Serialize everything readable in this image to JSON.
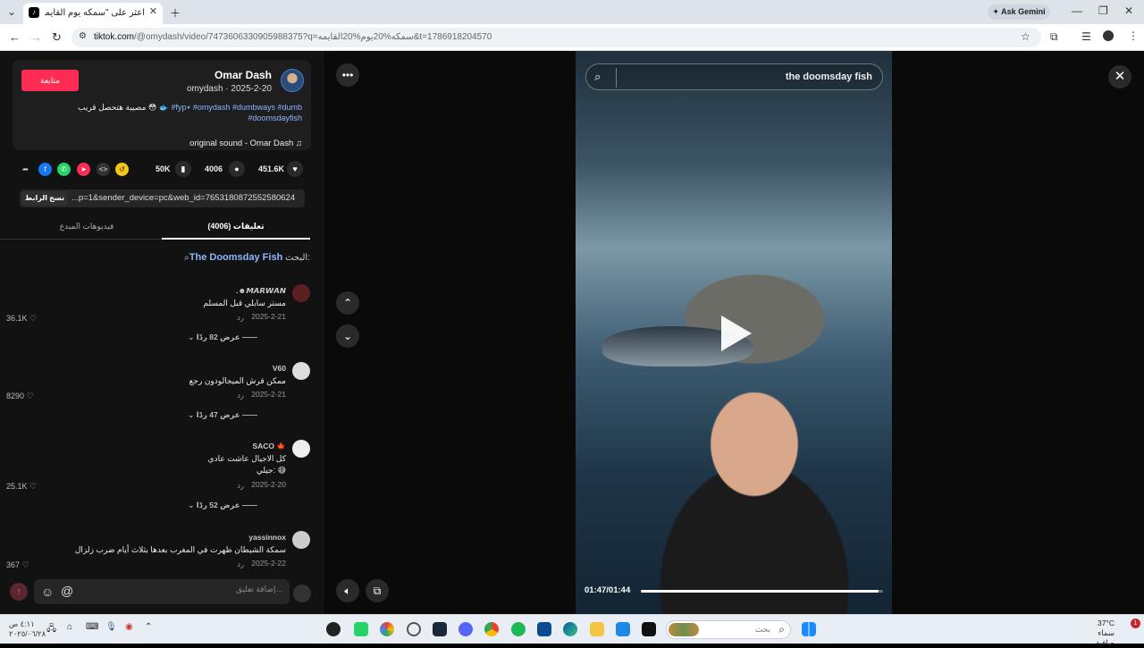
{
  "browser": {
    "tab_title": "اعثر على \"سمكه يوم القايمه\" على",
    "tab_favicon": "tiktok-icon",
    "ask_gemini": "Ask Gemini",
    "url_host": "tiktok.com",
    "url_path": "/@omydash/video/7473606330905988375?q=سمكه%20يوم%20القايمه&t=1786918204570"
  },
  "post": {
    "follow_label": "متابعة",
    "author_name": "Omar Dash",
    "author_meta": "omydash · 2025-2-20",
    "description_text": "مصيبة هتحصل قريب 😳 🐟",
    "description_tags": "#fyp٭ #omydash #dumbways #dumb #doomsdayfish",
    "sound": "original sound - Omar Dash"
  },
  "actions": {
    "likes": "451.6K",
    "comments": "4006",
    "saves": "50K",
    "copy_link_label": "نسخ الرابط",
    "link_text": "...p=1&sender_device=pc&web_id=7653180872552580624"
  },
  "tabs": {
    "comments": "(4006) تعليقات",
    "creator_videos": "فيديوهات المبدع"
  },
  "search_hint": {
    "prefix": "البحث:",
    "query": "The Doomsday Fish"
  },
  "comments": [
    {
      "user": ".☻𝙈𝘼𝙍𝙒𝘼𝙉",
      "text": "مستر سابلي قبل المسلم",
      "date": "2025-2-21",
      "reply": "رد",
      "likes": "36.1K",
      "more": "عرض 82 ردًا"
    },
    {
      "user": "V60",
      "text": "ممكن قرش الميجالودون رجع",
      "date": "2025-2-21",
      "reply": "رد",
      "likes": "8290",
      "more": "عرض 47 ردًا"
    },
    {
      "user": "SACO 🍁",
      "text": "كل الاجيال عاشت عادي",
      "text2": "جيلي: 😅",
      "date": "2025-2-20",
      "reply": "رد",
      "likes": "25.1K",
      "more": "عرض 52 ردًا"
    },
    {
      "user": "yassinnox",
      "text": "سمكة الشيطان ظهرت في المغرب بعدها بثلاث أيام ضرب زلزال",
      "date": "2025-2-22",
      "reply": "رد",
      "likes": "367"
    }
  ],
  "composer": {
    "placeholder": "إضافة تعليق..."
  },
  "video": {
    "search_query": "the doomsday fish",
    "time": "01:47/01:44",
    "progress": 0.98
  },
  "taskbar": {
    "search_placeholder": "بحث",
    "weather_temp": "37°C",
    "weather_desc": "سماء صافية",
    "clock_time": "٤:١١ ص",
    "clock_date": "٢٠٢٥/٠٦/٢٨",
    "notification_count": "1"
  }
}
